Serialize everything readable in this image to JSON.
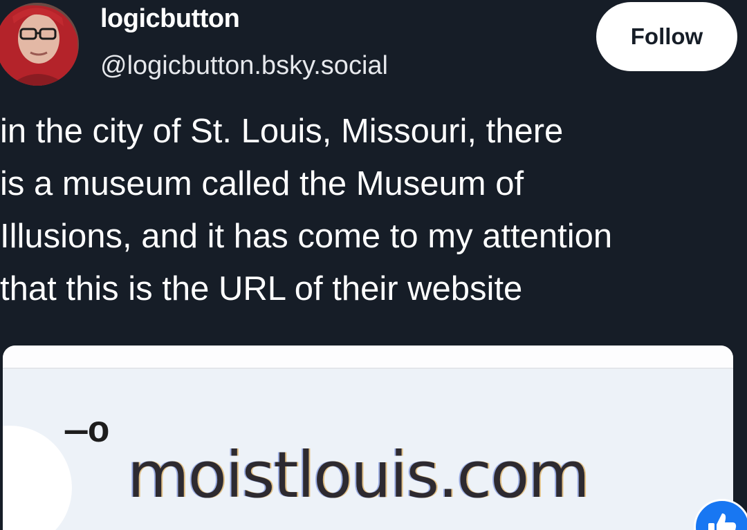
{
  "author": {
    "display_name": "logicbutton",
    "handle": "@logicbutton.bsky.social",
    "avatar_icon": "avatar-icon"
  },
  "follow_button": {
    "label": "Follow"
  },
  "post": {
    "lines": [
      "in the city of St. Louis, Missouri, there",
      "is a museum called the Museum of",
      "Illusions, and it has come to my attention",
      "that this is the URL of their website"
    ]
  },
  "embed": {
    "url_text": "moistlouis.com",
    "site_icon_glyph": "―o",
    "site_icon": "site-info-icon"
  },
  "reaction": {
    "icon": "thumbs-up-icon",
    "color": "#1877f2"
  },
  "colors": {
    "background": "#161d27",
    "text": "#ffffff",
    "follow_bg": "#ffffff",
    "card_bg": "#edf2f8"
  }
}
